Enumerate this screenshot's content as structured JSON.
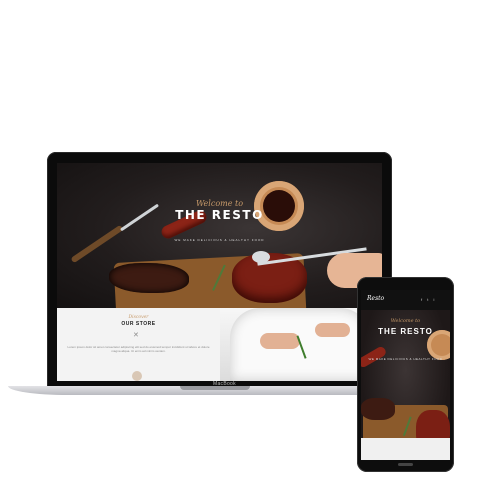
{
  "laptop": {
    "brand": "MacBook",
    "hero": {
      "script": "Welcome to",
      "title": "THE RESTO",
      "subtitle": "WE MAKE DELICIOUS & HEALTHY FOOD"
    },
    "store": {
      "script": "Discover",
      "title": "OUR STORE",
      "icon": "utensils-icon",
      "text": "Lorem ipsum dolor sit amet consectetur adipiscing elit sed do eiusmod tempor incididunt ut labore et dolore magna aliqua. Ut enim ad minim veniam."
    }
  },
  "phone": {
    "logo": "Resto",
    "social_icons": "f t i",
    "hero": {
      "script": "Welcome to",
      "title": "THE RESTO",
      "subtitle": "WE MAKE DELICIOUS & HEALTHY FOOD"
    }
  },
  "colors": {
    "accent": "#c79a6a",
    "dark": "#1c1717"
  }
}
